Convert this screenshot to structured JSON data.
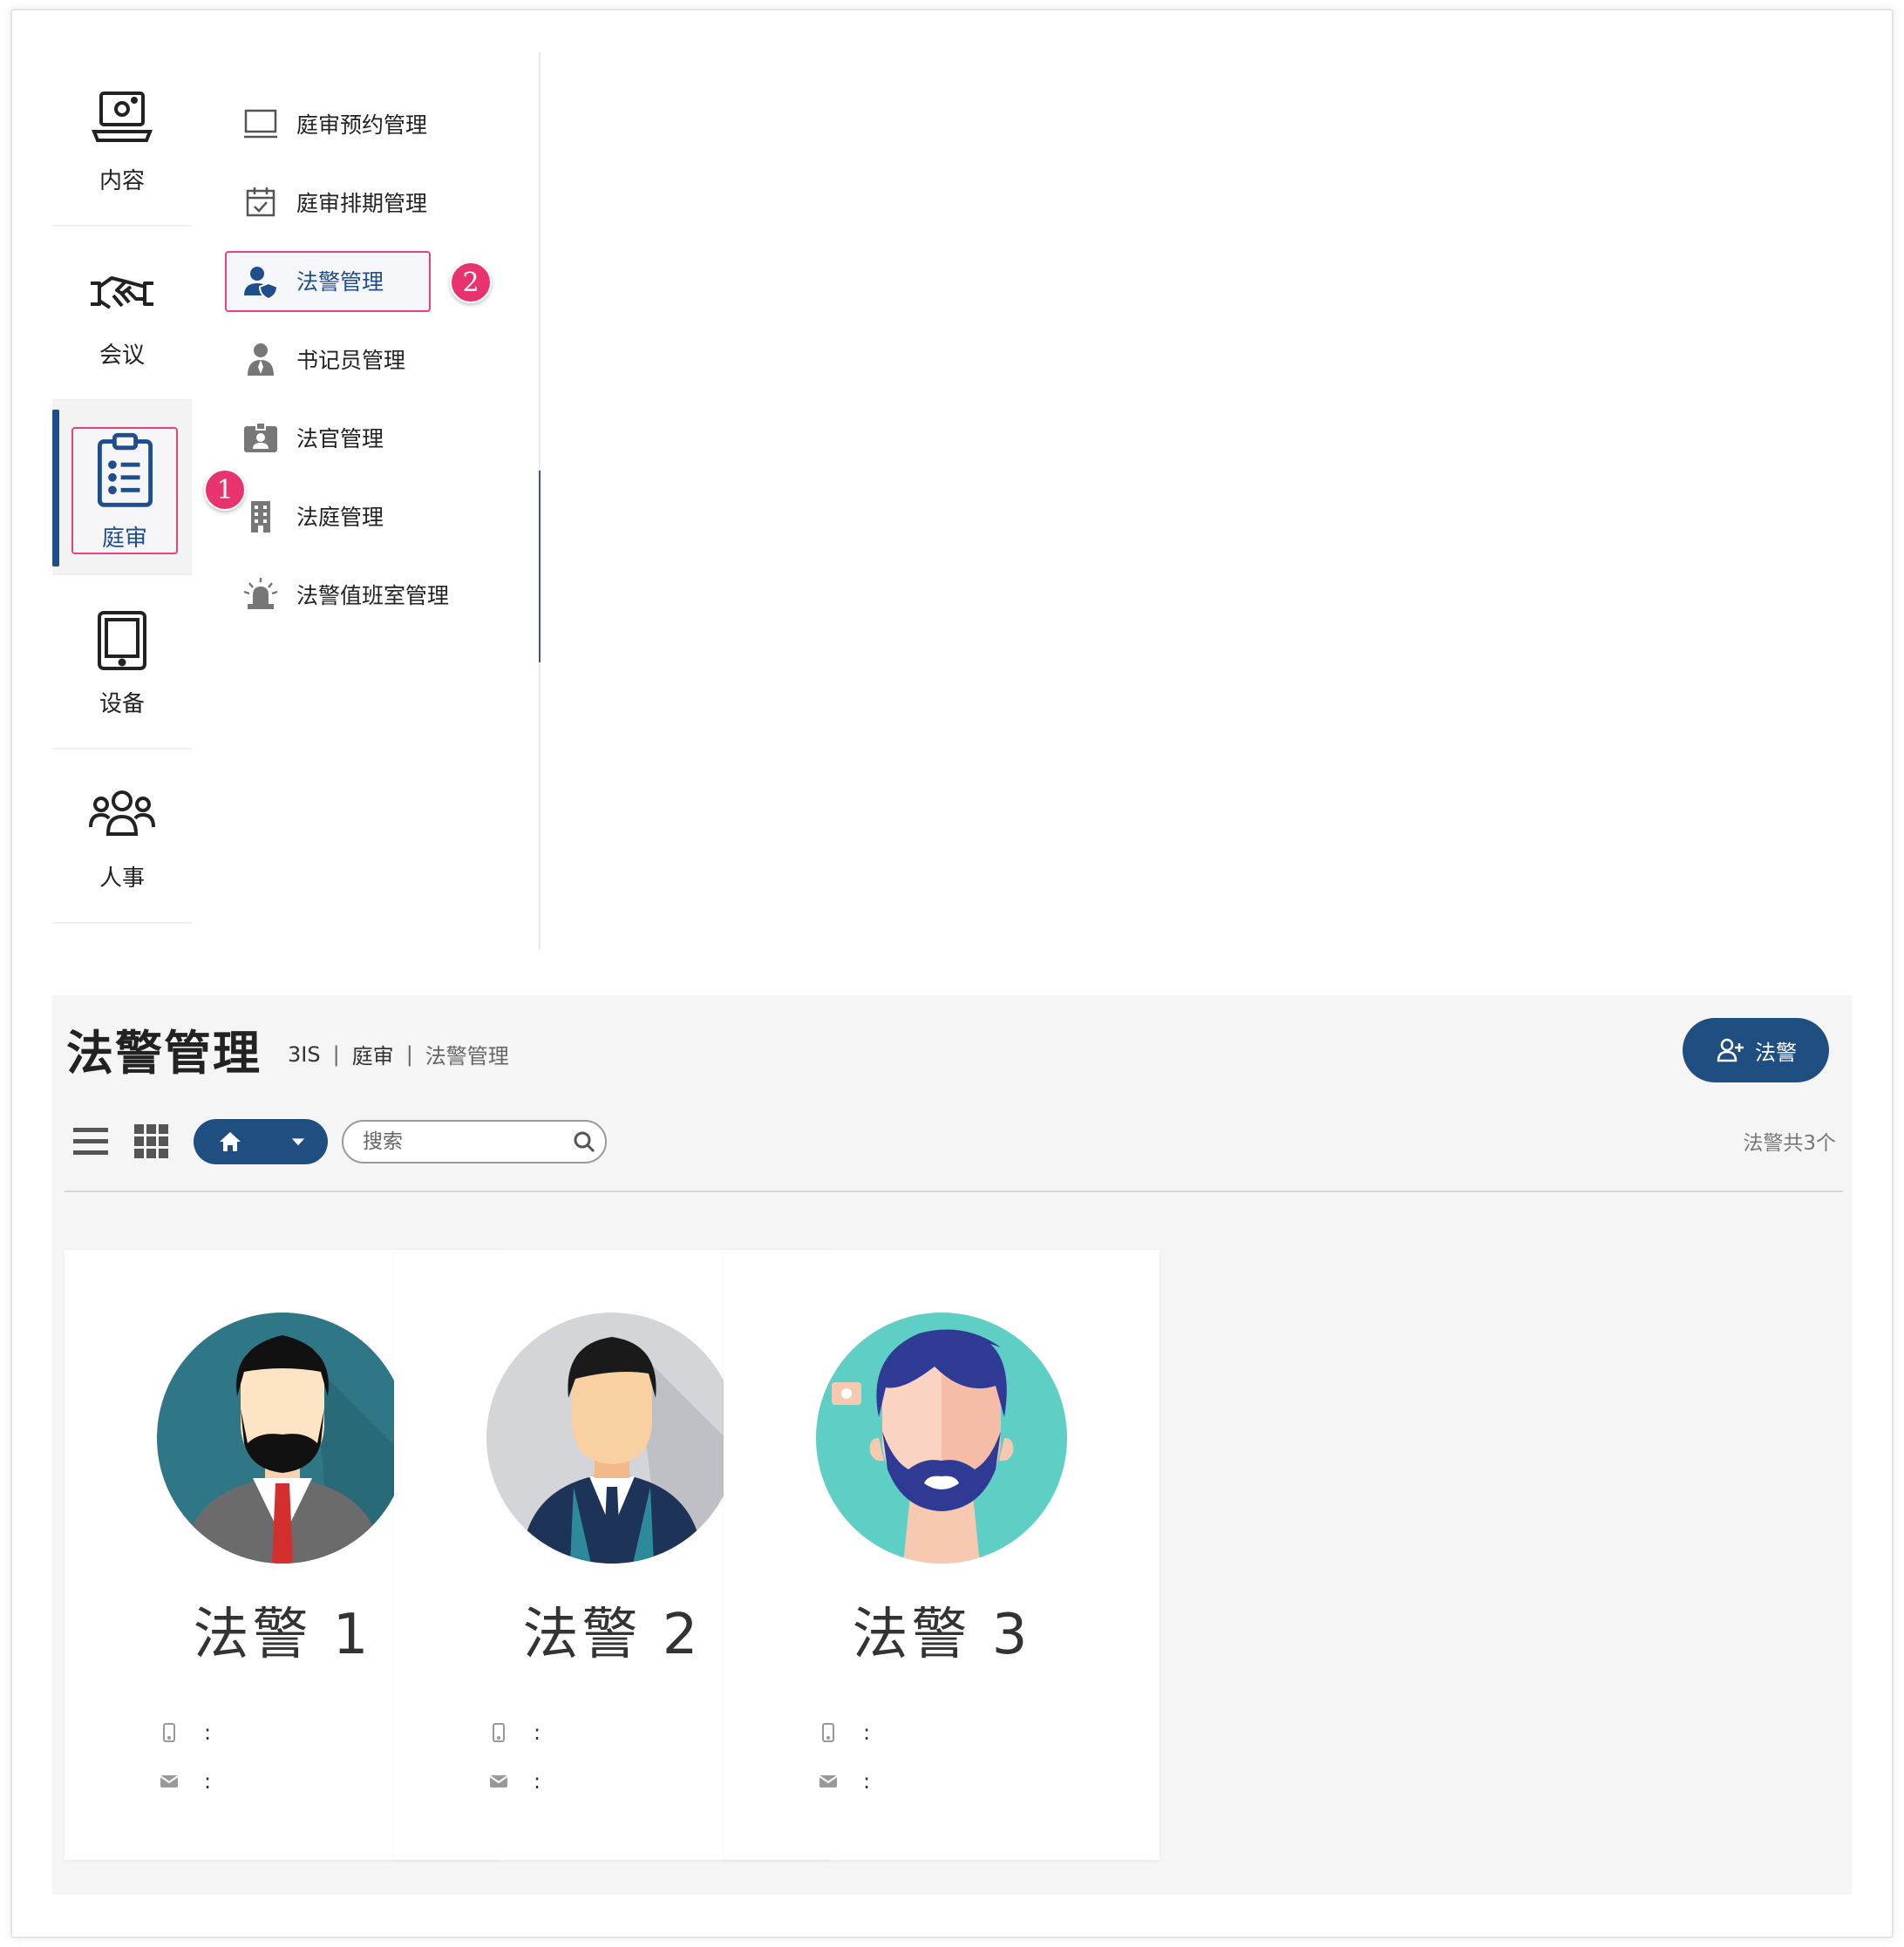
{
  "sidebar": {
    "rail": [
      {
        "label": "内容",
        "icon": "laptop-icon"
      },
      {
        "label": "会议",
        "icon": "handshake-icon"
      },
      {
        "label": "庭审",
        "icon": "clipboard-icon"
      },
      {
        "label": "设备",
        "icon": "tablet-icon"
      },
      {
        "label": "人事",
        "icon": "users-icon"
      }
    ],
    "active_rail": "庭审",
    "submenu": [
      {
        "label": "庭审预约管理",
        "icon": "monitor-icon"
      },
      {
        "label": "庭审排期管理",
        "icon": "calendar-check-icon"
      },
      {
        "label": "法警管理",
        "icon": "user-shield-icon"
      },
      {
        "label": "书记员管理",
        "icon": "user-tie-icon"
      },
      {
        "label": "法官管理",
        "icon": "id-badge-icon"
      },
      {
        "label": "法庭管理",
        "icon": "building-icon"
      },
      {
        "label": "法警值班室管理",
        "icon": "siren-icon"
      }
    ],
    "active_submenu": "法警管理"
  },
  "annotations": {
    "step1": "1",
    "step2": "2"
  },
  "page": {
    "title": "法警管理",
    "breadcrumb": [
      "3IS",
      "庭审",
      "法警管理"
    ],
    "breadcrumb_sep": "|",
    "add_button": "法警",
    "search_placeholder": "搜索",
    "count_text": "法警共3个"
  },
  "cards": [
    {
      "name": "法警 1",
      "phone_sep": ":",
      "email_sep": ":"
    },
    {
      "name": "法警 2",
      "phone_sep": ":",
      "email_sep": ":"
    },
    {
      "name": "法警 3",
      "phone_sep": ":",
      "email_sep": ":"
    }
  ],
  "colors": {
    "primary": "#1f4e80",
    "highlight": "#e8437c",
    "badge": "#e8336f"
  }
}
